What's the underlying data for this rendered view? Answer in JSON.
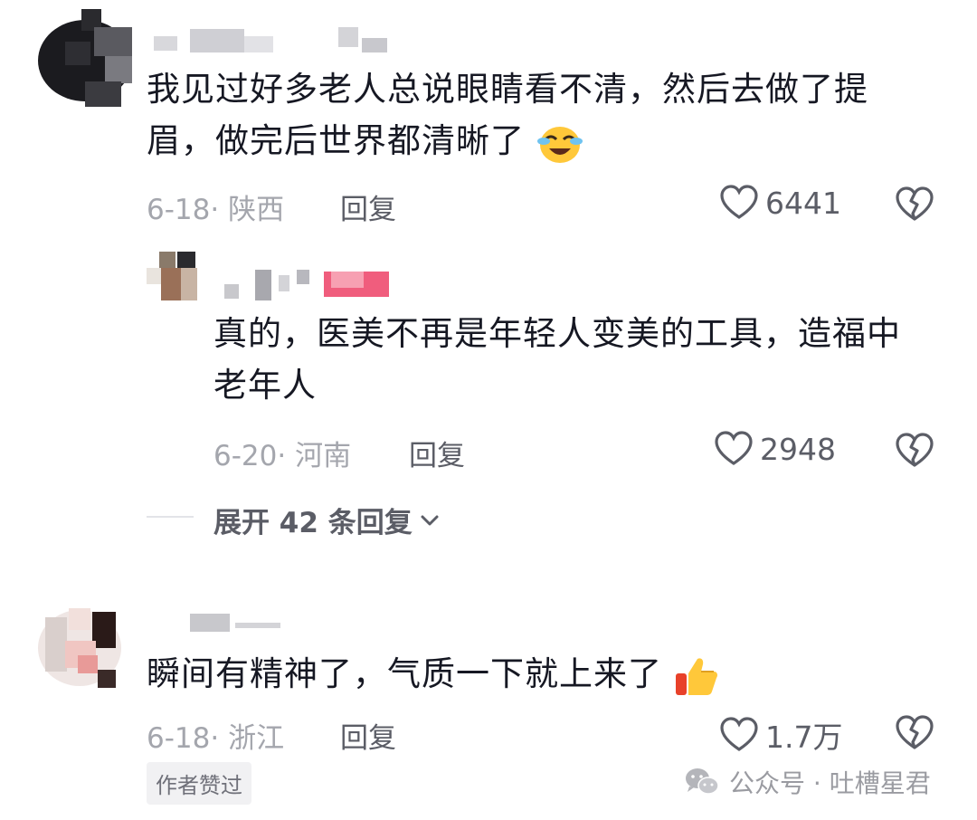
{
  "comments": [
    {
      "text_line1": "我见过好多老人总说眼睛看不清，然后去做了提",
      "text_line2": "眉，做完后世界都清晰了",
      "date_location": "6-18· 陕西",
      "reply_label": "回复",
      "likes": "6441",
      "emoji": "crying-laughing-emoji"
    },
    {
      "text_line1": "真的，医美不再是年轻人变美的工具，造福中",
      "text_line2": "老年人",
      "date_location": "6-20· 河南",
      "reply_label": "回复",
      "likes": "2948"
    },
    {
      "text_line1": "瞬间有精神了，气质一下就上来了",
      "date_location": "6-18· 浙江",
      "reply_label": "回复",
      "likes": "1.7万",
      "emoji": "thumbs-up-emoji",
      "author_badge": "作者赞过"
    }
  ],
  "expand_replies": {
    "label": "展开 42 条回复"
  },
  "watermark": {
    "text": "公众号 · 吐槽星君",
    "icon": "wechat-icon"
  },
  "colors": {
    "text": "#161823",
    "meta": "#a4a6ad",
    "action": "#5b5d66",
    "heart": "#5b5d66"
  }
}
